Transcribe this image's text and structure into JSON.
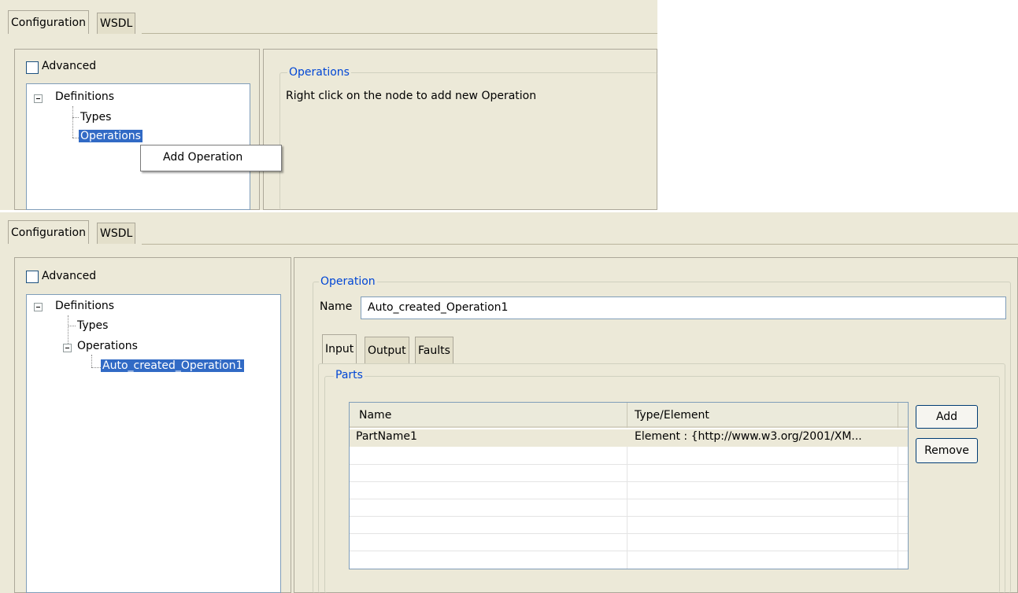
{
  "top": {
    "tabs": [
      {
        "label": "Configuration"
      },
      {
        "label": "WSDL"
      }
    ],
    "advanced_label": "Advanced",
    "tree": {
      "root": "Definitions",
      "children": [
        "Types",
        "Operations"
      ]
    },
    "context_menu": {
      "item": "Add Operation"
    },
    "group_title": "Operations",
    "hint": "Right click on the node to add new Operation"
  },
  "bottom": {
    "tabs": [
      {
        "label": "Configuration"
      },
      {
        "label": "WSDL"
      }
    ],
    "advanced_label": "Advanced",
    "tree": {
      "root": "Definitions",
      "types": "Types",
      "operations": "Operations",
      "operation_child": "Auto_created_Operation1"
    },
    "group_title": "Operation",
    "name_label": "Name",
    "name_value": "Auto_created_Operation1",
    "subtabs": [
      {
        "label": "Input"
      },
      {
        "label": "Output"
      },
      {
        "label": "Faults"
      }
    ],
    "parts_title": "Parts",
    "table": {
      "columns": [
        "Name",
        "Type/Element"
      ],
      "rows": [
        {
          "name": "PartName1",
          "type": "Element : {http://www.w3.org/2001/XM..."
        }
      ]
    },
    "buttons": {
      "add": "Add",
      "remove": "Remove"
    }
  }
}
